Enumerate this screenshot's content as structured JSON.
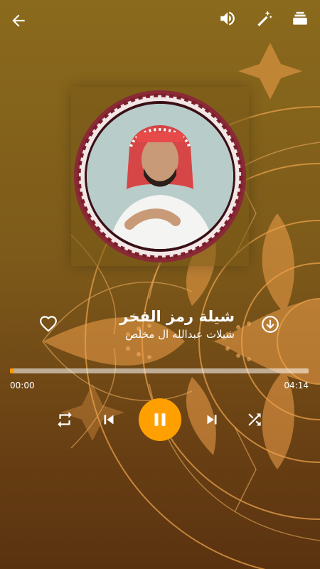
{
  "player": {
    "song_title": "شيلة رمز الفخر",
    "artist": "شيلات عبدالله ال مخلص",
    "current_time": "00:00",
    "total_time": "04:14",
    "progress_fraction": 0.015,
    "is_playing": true
  },
  "icons": {
    "back": "arrow-left-icon",
    "volume": "volume-icon",
    "effects": "magic-wand-icon",
    "queue": "layers-icon",
    "favorite": "heart-outline-icon",
    "download": "download-circle-icon",
    "repeat": "repeat-icon",
    "previous": "skip-previous-icon",
    "pause": "pause-icon",
    "next": "skip-next-icon",
    "shuffle": "shuffle-icon"
  },
  "colors": {
    "accent": "#ffa000",
    "progress_track": "#d9c9a6",
    "frame_maroon": "#7a1e2a"
  }
}
